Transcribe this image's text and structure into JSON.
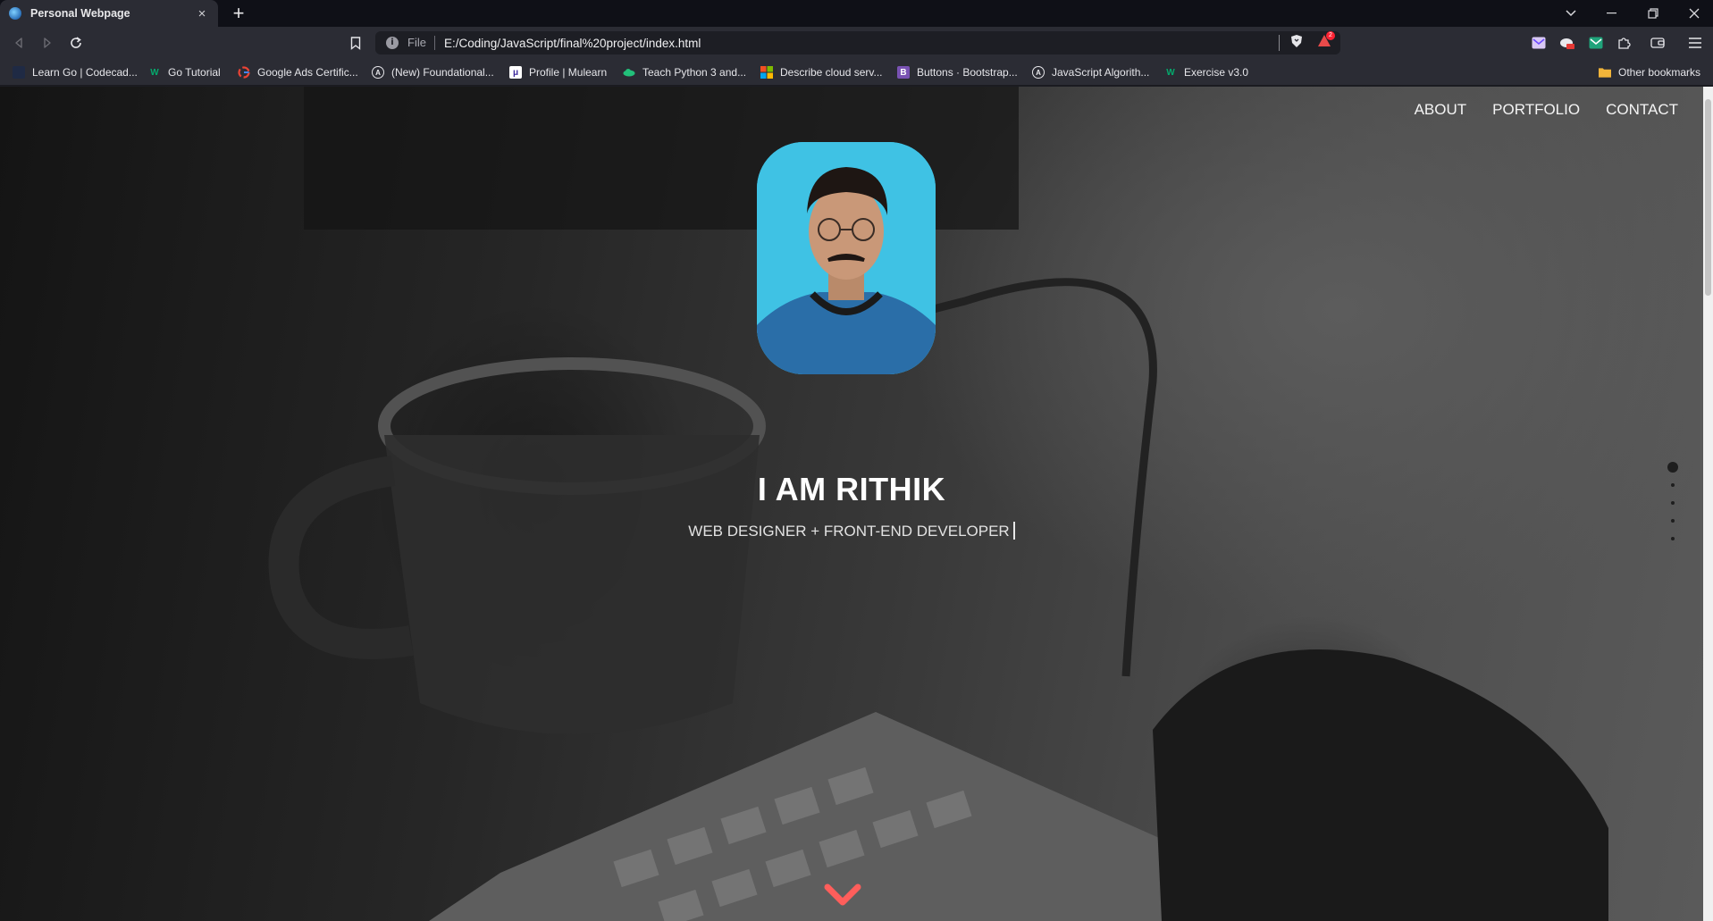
{
  "browser": {
    "tab_title": "Personal Webpage",
    "tab_close": "×",
    "new_tab": "+",
    "url_scheme": "File",
    "url": "E:/Coding/JavaScript/final%20project/index.html",
    "rewards_badge": "2"
  },
  "bookmarks": {
    "items": [
      {
        "label": "Learn Go | Codecad...",
        "icon": "codecademy-icon"
      },
      {
        "label": "Go Tutorial",
        "icon": "w3schools-icon"
      },
      {
        "label": "Google Ads Certific...",
        "icon": "google-icon"
      },
      {
        "label": "(New) Foundational...",
        "icon": "academy-icon"
      },
      {
        "label": "Profile | Mulearn",
        "icon": "mulearn-icon"
      },
      {
        "label": "Teach Python 3 and...",
        "icon": "cloud-icon"
      },
      {
        "label": "Describe cloud serv...",
        "icon": "microsoft-icon"
      },
      {
        "label": "Buttons · Bootstrap...",
        "icon": "bootstrap-icon"
      },
      {
        "label": "JavaScript Algorith...",
        "icon": "academy-icon"
      },
      {
        "label": "Exercise v3.0",
        "icon": "w3schools-icon"
      }
    ],
    "other": "Other bookmarks"
  },
  "site": {
    "nav": [
      "ABOUT",
      "PORTFOLIO",
      "CONTACT"
    ],
    "name": "I AM RITHIK",
    "tagline": "WEB DESIGNER + FRONT-END DEVELOPER",
    "section_dots": 5,
    "active_dot": 0,
    "accent_color": "#ff5e5b"
  }
}
